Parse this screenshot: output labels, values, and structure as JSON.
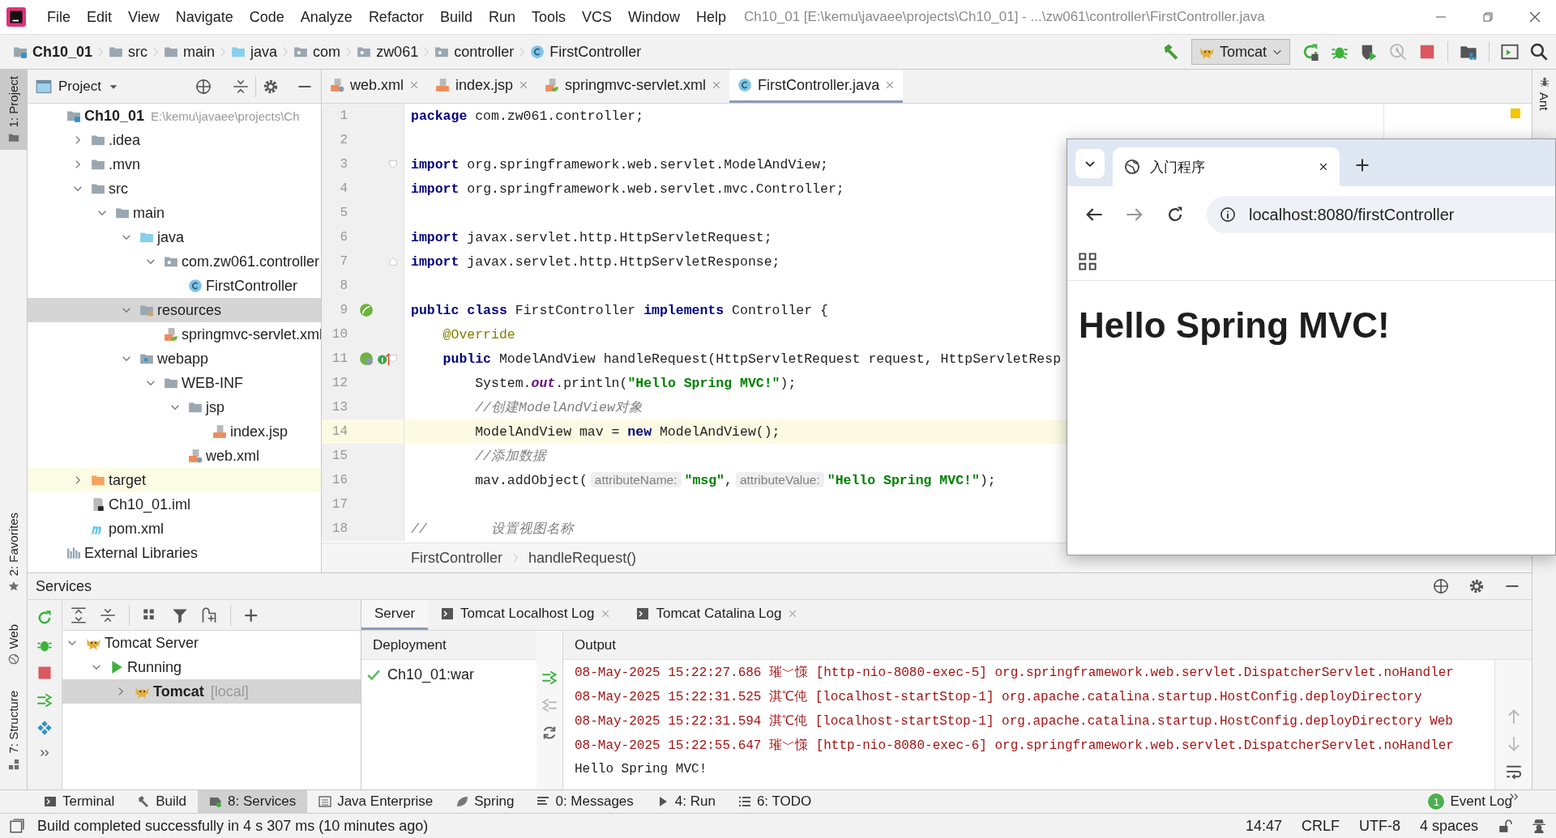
{
  "window": {
    "title": "Ch10_01 [E:\\kemu\\javaee\\projects\\Ch10_01] - ...\\zw061\\controller\\FirstController.java",
    "menu": [
      "File",
      "Edit",
      "View",
      "Navigate",
      "Code",
      "Analyze",
      "Refactor",
      "Build",
      "Run",
      "Tools",
      "VCS",
      "Window",
      "Help"
    ]
  },
  "navbar": {
    "breadcrumbs": [
      {
        "label": "Ch10_01",
        "kind": "module"
      },
      {
        "label": "src",
        "kind": "folder"
      },
      {
        "label": "main",
        "kind": "folder"
      },
      {
        "label": "java",
        "kind": "source"
      },
      {
        "label": "com",
        "kind": "package"
      },
      {
        "label": "zw061",
        "kind": "package"
      },
      {
        "label": "controller",
        "kind": "package"
      },
      {
        "label": "FirstController",
        "kind": "class"
      }
    ],
    "run_config": "Tomcat"
  },
  "left_stripe": [
    {
      "label": "1: Project",
      "kind": "project",
      "selected": true
    },
    {
      "label": "2: Favorites",
      "kind": "favorites",
      "selected": false
    },
    {
      "label": "Web",
      "kind": "web",
      "selected": false
    },
    {
      "label": "7: Structure",
      "kind": "structure",
      "selected": false
    }
  ],
  "right_stripe": [
    {
      "label": "Ant",
      "kind": "ant",
      "selected": false
    }
  ],
  "project_panel": {
    "title": "Project",
    "tree": [
      {
        "label": "Ch10_01",
        "path": "E:\\kemu\\javaee\\projects\\Ch",
        "kind": "module",
        "selected": false,
        "children": [
          {
            "label": ".idea",
            "kind": "folder",
            "expanded": false,
            "selected": false
          },
          {
            "label": ".mvn",
            "kind": "folder",
            "expanded": false,
            "selected": false
          },
          {
            "label": "src",
            "kind": "folder",
            "expanded": true,
            "selected": false,
            "children": [
              {
                "label": "main",
                "kind": "folder",
                "expanded": true,
                "selected": false,
                "children": [
                  {
                    "label": "java",
                    "kind": "source",
                    "expanded": true,
                    "selected": false,
                    "children": [
                      {
                        "label": "com.zw061.controller",
                        "kind": "package",
                        "expanded": true,
                        "selected": false,
                        "children": [
                          {
                            "label": "FirstController",
                            "kind": "class",
                            "selected": false
                          }
                        ]
                      }
                    ]
                  },
                  {
                    "label": "resources",
                    "kind": "resources",
                    "expanded": true,
                    "selected": true,
                    "children": [
                      {
                        "label": "springmvc-servlet.xml",
                        "kind": "spring-xml",
                        "selected": false
                      }
                    ]
                  },
                  {
                    "label": "webapp",
                    "kind": "web",
                    "expanded": true,
                    "selected": false,
                    "children": [
                      {
                        "label": "WEB-INF",
                        "kind": "folder",
                        "expanded": true,
                        "selected": false,
                        "children": [
                          {
                            "label": "jsp",
                            "kind": "folder",
                            "expanded": true,
                            "selected": false,
                            "children": [
                              {
                                "label": "index.jsp",
                                "kind": "jsp",
                                "selected": false
                              }
                            ]
                          },
                          {
                            "label": "web.xml",
                            "kind": "web-xml",
                            "selected": false
                          }
                        ]
                      }
                    ]
                  }
                ]
              }
            ]
          },
          {
            "label": "target",
            "kind": "excluded",
            "expanded": false,
            "selected": false
          },
          {
            "label": "Ch10_01.iml",
            "kind": "iml",
            "selected": false
          },
          {
            "label": "pom.xml",
            "kind": "maven",
            "selected": false
          }
        ]
      },
      {
        "label": "External Libraries",
        "kind": "libraries",
        "selected": false
      }
    ]
  },
  "editor": {
    "tabs": [
      {
        "label": "web.xml",
        "kind": "web-xml",
        "selected": false
      },
      {
        "label": "index.jsp",
        "kind": "jsp",
        "selected": false
      },
      {
        "label": "springmvc-servlet.xml",
        "kind": "spring-xml",
        "selected": false
      },
      {
        "label": "FirstController.java",
        "kind": "class",
        "selected": true
      }
    ],
    "lines": [
      {
        "number": "1",
        "current": false,
        "tokens": [
          {
            "kind": "kw",
            "text": "package"
          },
          {
            "kind": "plain",
            "text": " com.zw061.controller;"
          }
        ]
      },
      {
        "number": "2",
        "current": false
      },
      {
        "number": "3",
        "current": false,
        "markers": [
          {
            "kind": "fold-open"
          }
        ],
        "tokens": [
          {
            "kind": "kw",
            "text": "import"
          },
          {
            "kind": "plain",
            "text": " org.springframework.web.servlet.ModelAndView;"
          }
        ]
      },
      {
        "number": "4",
        "current": false,
        "tokens": [
          {
            "kind": "kw",
            "text": "import"
          },
          {
            "kind": "plain",
            "text": " org.springframework.web.servlet.mvc.Controller;"
          }
        ]
      },
      {
        "number": "5",
        "current": false
      },
      {
        "number": "6",
        "current": false,
        "tokens": [
          {
            "kind": "kw",
            "text": "import"
          },
          {
            "kind": "plain",
            "text": " javax.servlet.http.HttpServletRequest;"
          }
        ]
      },
      {
        "number": "7",
        "current": false,
        "markers": [
          {
            "kind": "fold-close"
          }
        ],
        "tokens": [
          {
            "kind": "kw",
            "text": "import"
          },
          {
            "kind": "plain",
            "text": " javax.servlet.http.HttpServletResponse;"
          }
        ]
      },
      {
        "number": "8",
        "current": false
      },
      {
        "number": "9",
        "current": false,
        "markers": [
          {
            "kind": "bean"
          }
        ],
        "tokens": [
          {
            "kind": "kw",
            "text": "public class"
          },
          {
            "kind": "plain",
            "text": " FirstController "
          },
          {
            "kind": "kw",
            "text": "implements"
          },
          {
            "kind": "plain",
            "text": " Controller {"
          }
        ]
      },
      {
        "number": "10",
        "current": false,
        "tokens": [
          {
            "kind": "annotation",
            "text": "    @Override"
          }
        ]
      },
      {
        "number": "11",
        "current": false,
        "markers": [
          {
            "kind": "bean-override"
          },
          {
            "kind": "fold-open"
          }
        ],
        "tokens": [
          {
            "kind": "kw",
            "text": "    public"
          },
          {
            "kind": "plain",
            "text": " ModelAndView handleRequest(HttpServletRequest request, HttpServletResp"
          }
        ]
      },
      {
        "number": "12",
        "current": false,
        "tokens": [
          {
            "kind": "plain",
            "text": "        System."
          },
          {
            "kind": "static",
            "text": "out"
          },
          {
            "kind": "plain",
            "text": ".println("
          },
          {
            "kind": "str",
            "text": "\"Hello Spring MVC!\""
          },
          {
            "kind": "plain",
            "text": ");"
          }
        ]
      },
      {
        "number": "13",
        "current": false,
        "tokens": [
          {
            "kind": "comment",
            "text": "        //创建ModelAndView对象"
          }
        ]
      },
      {
        "number": "14",
        "current": true,
        "tokens": [
          {
            "kind": "plain",
            "text": "        ModelAndView mav = "
          },
          {
            "kind": "kw",
            "text": "new"
          },
          {
            "kind": "plain",
            "text": " ModelAndView();"
          }
        ]
      },
      {
        "number": "15",
        "current": false,
        "tokens": [
          {
            "kind": "comment",
            "text": "        //添加数据"
          }
        ]
      },
      {
        "number": "16",
        "current": false,
        "tokens": [
          {
            "kind": "plain",
            "text": "        mav.addObject("
          },
          {
            "kind": "hint",
            "text": "attributeName:"
          },
          {
            "kind": "str",
            "text": "\"msg\""
          },
          {
            "kind": "plain",
            "text": ","
          },
          {
            "kind": "hint",
            "text": "attributeValue:"
          },
          {
            "kind": "str",
            "text": "\"Hello Spring MVC!\""
          },
          {
            "kind": "plain",
            "text": ");"
          }
        ]
      },
      {
        "number": "17",
        "current": false
      },
      {
        "number": "18",
        "current": false,
        "tokens": [
          {
            "kind": "comment",
            "text": "//        设置视图名称"
          }
        ]
      }
    ],
    "breadcrumbs": [
      "FirstController",
      "handleRequest()"
    ]
  },
  "browser": {
    "tab_title": "入门程序",
    "address": "localhost:8080/firstController",
    "heading": "Hello Spring MVC!"
  },
  "services": {
    "title": "Services",
    "tree": [
      {
        "label": "Tomcat Server",
        "kind": "server",
        "expanded": true,
        "selected": false,
        "children": [
          {
            "label": "Running",
            "kind": "running",
            "expanded": true,
            "selected": false,
            "children": [
              {
                "label": "Tomcat",
                "suffix": "[local]",
                "kind": "instance",
                "expanded": false,
                "selected": true
              }
            ]
          }
        ]
      }
    ],
    "tabs": [
      {
        "label": "Server",
        "kind": "plain",
        "selected": true
      },
      {
        "label": "Tomcat Localhost Log",
        "kind": "log",
        "selected": false
      },
      {
        "label": "Tomcat Catalina Log",
        "kind": "log",
        "selected": false
      }
    ],
    "deployment": {
      "title": "Deployment",
      "items": [
        {
          "label": "Ch10_01:war"
        }
      ]
    },
    "output": {
      "title": "Output",
      "lines": [
        {
          "kind": "log",
          "text": "08-May-2025 15:22:27.686 璀﹀憡 [http-nio-8080-exec-5] org.springframework.web.servlet.DispatcherServlet.noHandler"
        },
        {
          "kind": "log",
          "text": "08-May-2025 15:22:31.525 淇℃伅 [localhost-startStop-1] org.apache.catalina.startup.HostConfig.deployDirectory"
        },
        {
          "kind": "log",
          "text": "08-May-2025 15:22:31.594 淇℃伅 [localhost-startStop-1] org.apache.catalina.startup.HostConfig.deployDirectory Web"
        },
        {
          "kind": "log",
          "text": "08-May-2025 15:22:55.647 璀﹀憡 [http-nio-8080-exec-6] org.springframework.web.servlet.DispatcherServlet.noHandler"
        },
        {
          "kind": "plain",
          "text": "Hello Spring MVC!"
        }
      ]
    }
  },
  "tool_windows": [
    {
      "label": "Terminal",
      "kind": "terminal",
      "selected": false
    },
    {
      "label": "Build",
      "kind": "build",
      "selected": false
    },
    {
      "label": "8: Services",
      "kind": "services",
      "selected": true
    },
    {
      "label": "Java Enterprise",
      "kind": "enterprise",
      "selected": false
    },
    {
      "label": "Spring",
      "kind": "spring",
      "selected": false
    },
    {
      "label": "0: Messages",
      "kind": "messages",
      "selected": false
    },
    {
      "label": "4: Run",
      "kind": "run",
      "selected": false
    },
    {
      "label": "6: TODO",
      "kind": "todo",
      "selected": false
    }
  ],
  "event_log": {
    "label": "Event Log",
    "badge": "1"
  },
  "status_bar": {
    "message": "Build completed successfully in 4 s 307 ms (10 minutes ago)",
    "items": [
      "14:47",
      "CRLF",
      "UTF-8",
      "4 spaces"
    ]
  }
}
